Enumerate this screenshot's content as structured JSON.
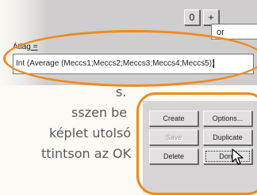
{
  "toolbar": {
    "zero_btn": "0",
    "plus_btn": "+",
    "operator_select": "or"
  },
  "formula": {
    "label_text": "Átlag",
    "label_suffix": " =",
    "value": "Int (Average (Meccs1;Meccs2;Meccs3;Meccs4;Meccs5))"
  },
  "instructions": {
    "lines": [
      "s.",
      "sszen be",
      "képlet utolsó",
      "ttintson az OK"
    ]
  },
  "buttons": {
    "create": "Create",
    "options": "Options...",
    "save": "Save",
    "duplicate": "Duplicate",
    "delete": "Delete",
    "done": "Done"
  },
  "colors": {
    "highlight": "#f08a1c",
    "dialog_bg": "#cfcdcd",
    "page_bg": "#fbfaf5"
  }
}
